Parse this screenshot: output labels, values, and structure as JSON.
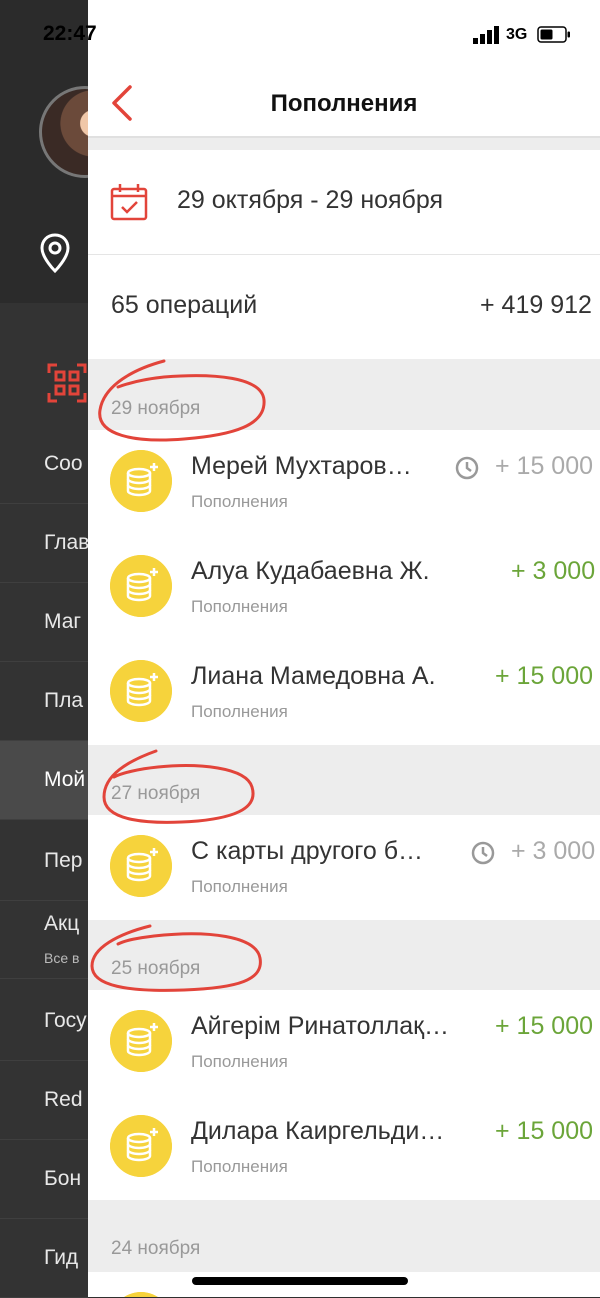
{
  "status_bar": {
    "time": "22:47",
    "network": "3G"
  },
  "sidebar": {
    "items": [
      {
        "label": "Соо",
        "active": false
      },
      {
        "label": "Глав",
        "active": false
      },
      {
        "label": "Маг",
        "active": false
      },
      {
        "label": "Пла",
        "active": false
      },
      {
        "label": "Мой",
        "active": true
      },
      {
        "label": "Пер",
        "active": false
      },
      {
        "label": "Акц",
        "active": false
      },
      {
        "label": "Госу",
        "active": false
      },
      {
        "label": "Red",
        "active": false
      },
      {
        "label": "Бон",
        "active": false
      },
      {
        "label": "Гид",
        "active": false
      }
    ],
    "sub_label": "Все в"
  },
  "header": {
    "title": "Пополнения"
  },
  "filter": {
    "date_range": "29 октября - 29 ноября"
  },
  "summary": {
    "operations": "65 операций",
    "total": "+ 419 912"
  },
  "sections": [
    {
      "date": "29 ноября"
    },
    {
      "date": "27 ноября"
    },
    {
      "date": "25 ноября"
    },
    {
      "date": "24 ноября"
    }
  ],
  "transactions": [
    {
      "name": "Мерей Мухтаров…",
      "category": "Пополнения",
      "amount": "+ 15 000",
      "pending": true
    },
    {
      "name": "Алуа Кудабаевна Ж.",
      "category": "Пополнения",
      "amount": "+ 3 000",
      "pending": false
    },
    {
      "name": "Лиана Мамедовна А.",
      "category": "Пополнения",
      "amount": "+ 15 000",
      "pending": false
    },
    {
      "name": "С карты другого б…",
      "category": "Пополнения",
      "amount": "+ 3 000",
      "pending": true
    },
    {
      "name": "Айгерім Ринатоллақ…",
      "category": "Пополнения",
      "amount": "+ 15 000",
      "pending": false
    },
    {
      "name": "Дилара Каиргельди…",
      "category": "Пополнения",
      "amount": "+ 15 000",
      "pending": false
    }
  ],
  "colors": {
    "accent_red": "#e2443a",
    "positive_green": "#6ba539",
    "coin_yellow": "#f6d33c"
  }
}
